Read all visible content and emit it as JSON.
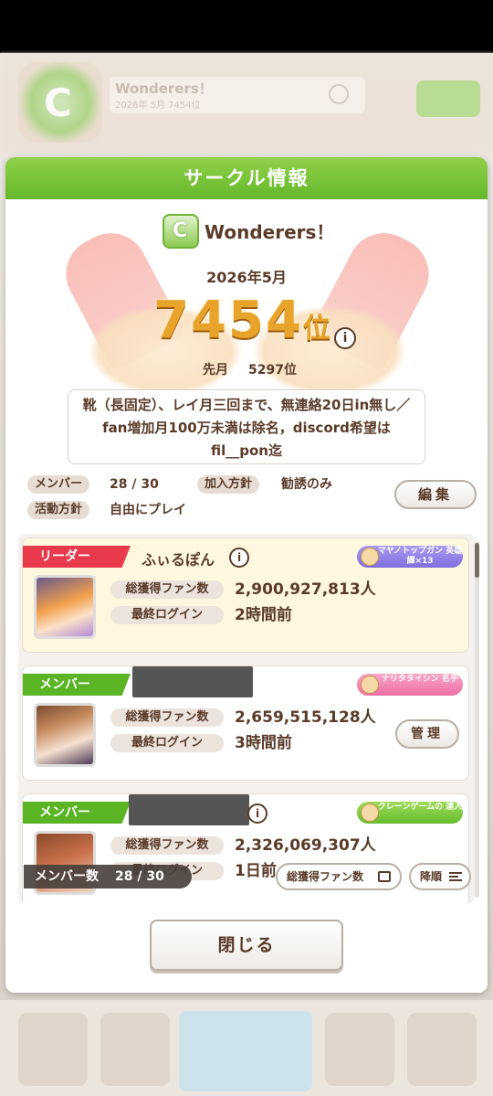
{
  "background": {
    "circle_name": "Wonderers！",
    "circle_sub": "2026年 5月 7454位"
  },
  "dialog": {
    "title": "サークル情報",
    "circle_name": "Wonderers！",
    "rank_period": "2026年5月",
    "rank_number": "7454",
    "rank_suffix": "位",
    "last_month_label": "先月",
    "last_month_value": "5297位",
    "description": "靴（長固定）、レイ月三回まで、無連絡20日in無し／fan増加月100万未満は除名，discord希望はfil__pon迄",
    "members_label": "メンバー",
    "members_value": "28 / 30",
    "join_policy_label": "加入方針",
    "join_policy_value": "勧誘のみ",
    "activity_policy_label": "活動方針",
    "activity_policy_value": "自由にプレイ",
    "edit_label": "編集",
    "close_label": "閉じる"
  },
  "members": [
    {
      "role": "リーダー",
      "name": "ふぃるぽん",
      "title": "マヤノトップガン 英雄譚×13",
      "fans_label": "総獲得ファン数",
      "fans": "2,900,927,813人",
      "login_label": "最終ログイン",
      "login": "2時間前"
    },
    {
      "role": "メンバー",
      "name": "",
      "title": "ナリタタイシン 名手",
      "fans_label": "総獲得ファン数",
      "fans": "2,659,515,128人",
      "login_label": "最終ログイン",
      "login": "3時間前",
      "manage_label": "管理"
    },
    {
      "role": "メンバー",
      "name": "",
      "title": "クレーンゲームの 達人",
      "fans_label": "総獲得ファン数",
      "fans": "2,326,069,307人",
      "login_label": "最終ログイン",
      "login": "1日前"
    }
  ],
  "list_footer": {
    "member_count_label": "メンバー数",
    "member_count_value": "28 / 30",
    "sort_field": "総獲得ファン数",
    "sort_order": "降順"
  },
  "icons": [
    "circle-rank-icon",
    "info-icon",
    "title-badge-icon",
    "sort-field-icon",
    "sort-order-icon"
  ],
  "colors": {
    "title_green": "#66b82a",
    "leader_red": "#e83a4c",
    "member_green": "#5ab423",
    "rank_gold": "#e8a42a",
    "text_brown": "#5a3b2a"
  }
}
